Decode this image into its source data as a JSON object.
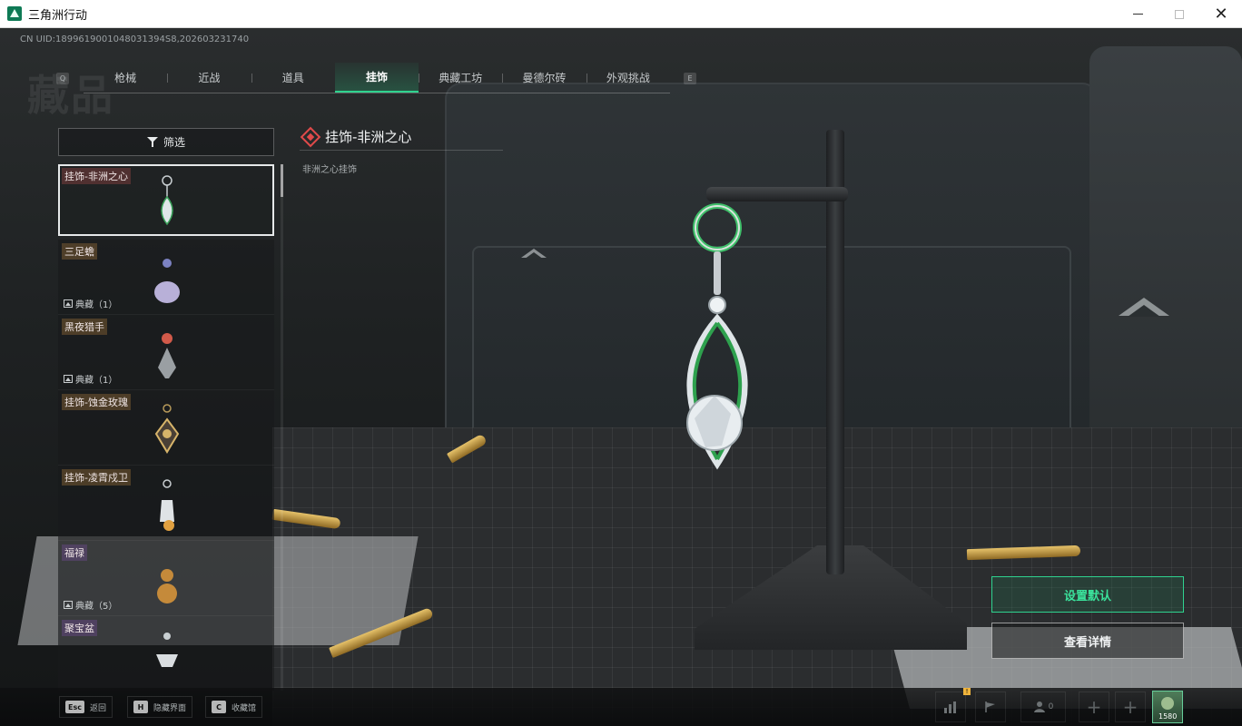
{
  "window": {
    "title": "三角洲行动",
    "controls": {
      "minimize": "—",
      "maximize": "□",
      "close": "✕"
    }
  },
  "uid_text": "CN UID:1899619001048031394S8,202603231740",
  "tabs": [
    {
      "label": "枪械",
      "active": false
    },
    {
      "label": "近战",
      "active": false
    },
    {
      "label": "道具",
      "active": false
    },
    {
      "label": "挂饰",
      "active": true
    },
    {
      "label": "典藏工坊",
      "active": false
    },
    {
      "label": "曼德尔砖",
      "active": false
    },
    {
      "label": "外观挑战",
      "active": false
    }
  ],
  "tab_keys": {
    "left": "Q",
    "right": "E"
  },
  "filter": {
    "label": "筛选",
    "icon": "funnel-icon"
  },
  "items": [
    {
      "name": "挂饰-非洲之心",
      "count": "",
      "selected": true
    },
    {
      "name": "三足蟾",
      "count": "典藏（1）",
      "selected": false
    },
    {
      "name": "黑夜猎手",
      "count": "典藏（1）",
      "selected": false
    },
    {
      "name": "挂饰-蚀金玫瑰",
      "count": "",
      "selected": false
    },
    {
      "name": "挂饰-凌霄戍卫",
      "count": "",
      "selected": false
    },
    {
      "name": "福禄",
      "count": "典藏（5）",
      "selected": false
    },
    {
      "name": "聚宝盆",
      "count": "",
      "selected": false
    }
  ],
  "detail": {
    "title": "挂饰-非洲之心",
    "description": "非洲之心挂饰"
  },
  "actions": {
    "set_default": "设置默认",
    "view_details": "查看详情"
  },
  "hints": [
    {
      "key": "Esc",
      "label": "返回"
    },
    {
      "key": "H",
      "label": "隐藏界面"
    },
    {
      "key": "C",
      "label": "收藏馆"
    }
  ],
  "tray": {
    "friends_count": "0",
    "notification": "!",
    "avatar_level": "1580"
  },
  "colors": {
    "accent": "#2fd28f",
    "rarity_red": "#e04a4a"
  }
}
